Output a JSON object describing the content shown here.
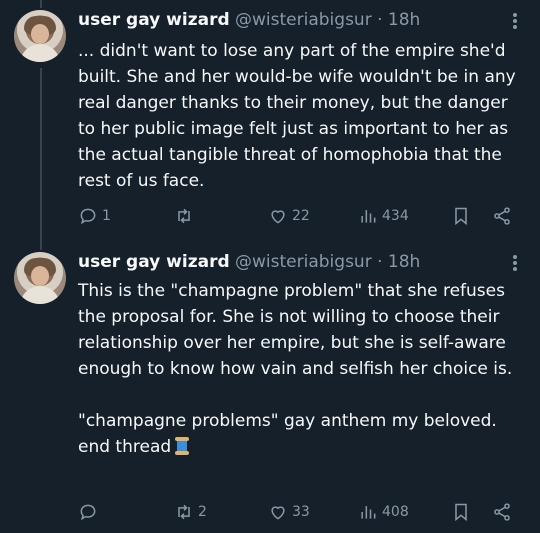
{
  "tweets": [
    {
      "display_name": "user gay wizard",
      "handle": "@wisteriabigsur",
      "separator": "·",
      "time": "18h",
      "text": "... didn't want to lose any part of the empire she'd built. She and her would-be wife wouldn't be in any real danger thanks to their money, but the danger to her public image felt just as important to her as the actual tangible threat of homophobia that the rest of us face.",
      "reply_count": "1",
      "retweet_count": "",
      "like_count": "22",
      "view_count": "434"
    },
    {
      "display_name": "user gay wizard",
      "handle": "@wisteriabigsur",
      "separator": "·",
      "time": "18h",
      "text": "This is the \"champagne problem\" that she refuses the proposal for. She is not willing to choose their relationship over her empire, but she is self-aware enough to know how vain and selfish her choice is.\n\n\"champagne problems\" gay anthem my beloved. end thread",
      "emoji": "spool-of-thread",
      "reply_count": "",
      "retweet_count": "2",
      "like_count": "33",
      "view_count": "408"
    }
  ],
  "icons": {
    "reply": "reply-icon",
    "retweet": "retweet-icon",
    "like": "like-icon",
    "views": "views-icon",
    "bookmark": "bookmark-icon",
    "share": "share-icon",
    "more": "more-icon"
  },
  "colors": {
    "background": "#15202b",
    "text": "#f7f9f9",
    "secondary": "#8b98a5",
    "thread_line": "#38444d"
  }
}
